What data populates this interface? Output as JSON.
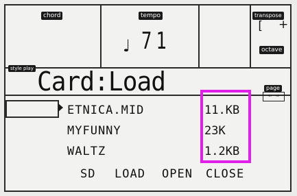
{
  "header": {
    "chord_label": "chord",
    "tempo_label": "tempo",
    "tempo_value": "71",
    "tempo_note": "♩",
    "transpose_label": "transpose",
    "transpose_value": "[",
    "transpose_sign": "+",
    "octave_label": "octave"
  },
  "title_bar": {
    "mode_label": "style play",
    "title": "Card:Load",
    "page_label": "page"
  },
  "files": [
    {
      "name": "ETNICA.MID",
      "size": "11.KB"
    },
    {
      "name": "MYFUNNY",
      "size": "23K"
    },
    {
      "name": "WALTZ",
      "size": "1.2KB"
    }
  ],
  "buttons": {
    "sd": "SD",
    "load": "LOAD",
    "open": "OPEN",
    "close": "CLOSE"
  },
  "colors": {
    "highlight": "#e020e8"
  }
}
